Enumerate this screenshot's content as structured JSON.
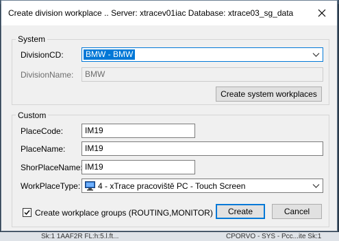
{
  "dialog": {
    "title": "Create division workplace .. Server: xtracev01iac   Database: xtrace03_sg_data",
    "close_icon": "close-icon"
  },
  "system": {
    "group_label": "System",
    "division_cd_label": "DivisionCD:",
    "division_cd_value": "BMW - BMW",
    "division_name_label": "DivisionName:",
    "division_name_value": "BMW",
    "create_system_button": "Create system workplaces"
  },
  "custom": {
    "group_label": "Custom",
    "place_code_label": "PlaceCode:",
    "place_code_value": "IM19",
    "place_name_label": "PlaceName:",
    "place_name_value": "IM19",
    "short_place_name_label": "ShorPlaceName:",
    "short_place_name_value": "IM19",
    "workplace_type_label": "WorkPlaceType:",
    "workplace_type_value": "4 - xTrace pracoviště PC - Touch Screen",
    "workplace_type_icon": "computer-icon"
  },
  "footer": {
    "checkbox_label": "Create workplace groups (ROUTING,MONITOR)",
    "checkbox_checked": true,
    "create_button": "Create",
    "cancel_button": "Cancel"
  },
  "background": {
    "bottom_text_left": "Sk:1   1AAF2R FL:h:5.l.ft...",
    "bottom_text_right": "CPORVO - SYS - Pcc...ite   Sk:1"
  }
}
